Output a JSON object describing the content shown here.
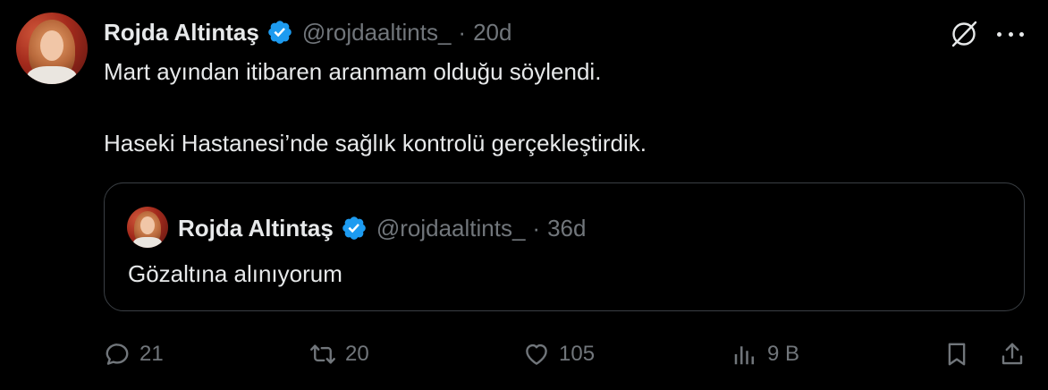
{
  "tweet": {
    "author_name": "Rojda Altintaş",
    "handle": "@rojdaaltints_",
    "separator": "·",
    "time": "20d",
    "text_line1": "Mart ayından itibaren aranmam olduğu söylendi.",
    "text_line2": "Haseki Hastanesi’nde sağlık kontrolü gerçekleştirdik."
  },
  "quoted": {
    "author_name": "Rojda Altintaş",
    "handle": "@rojdaaltints_",
    "separator": "·",
    "time": "36d",
    "text": "Gözaltına alınıyorum"
  },
  "actions": {
    "replies": "21",
    "reposts": "20",
    "likes": "105",
    "views": "9 B"
  },
  "icons": {
    "verified": "verified-badge-icon",
    "grok": "grok-icon",
    "more": "more-icon",
    "reply": "reply-icon",
    "repost": "repost-icon",
    "like": "heart-icon",
    "views": "views-icon",
    "bookmark": "bookmark-icon",
    "share": "share-icon"
  },
  "colors": {
    "background": "#000000",
    "text": "#e7e9ea",
    "muted": "#71767b",
    "verified": "#1d9bf0",
    "border": "#3a3f44"
  }
}
